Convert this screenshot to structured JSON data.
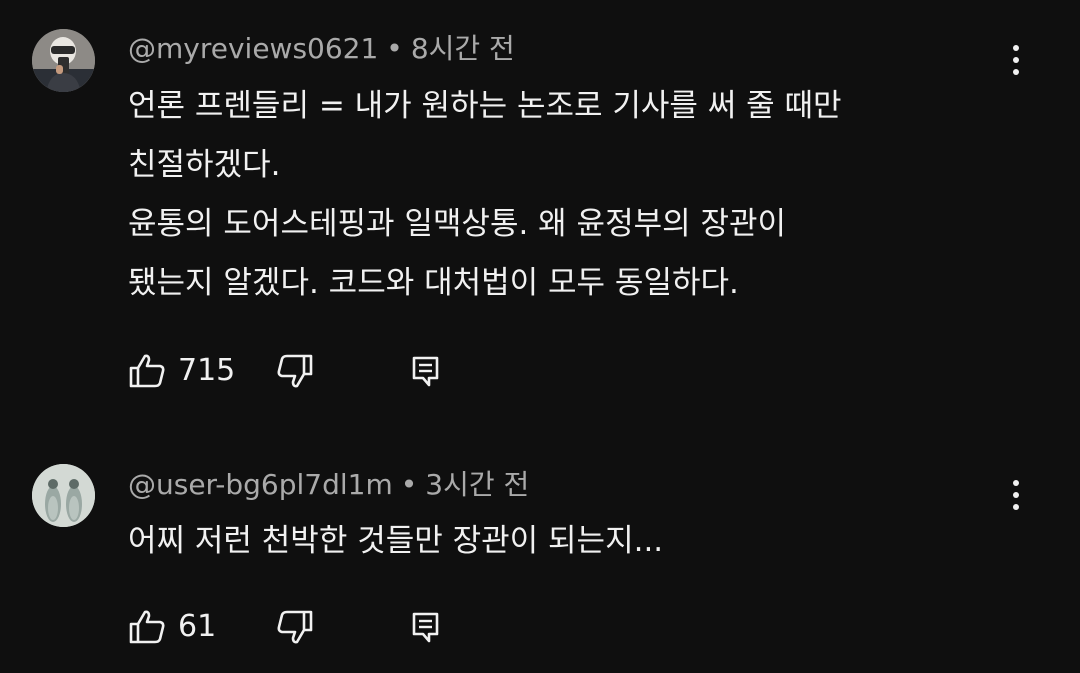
{
  "comments": [
    {
      "handle": "@myreviews0621",
      "separator": "•",
      "time": "8시간 전",
      "lines": [
        "언론 프렌들리 = 내가 원하는 논조로 기사를 써 줄 때만",
        "친절하겠다.",
        "윤통의 도어스테핑과 일맥상통. 왜 윤정부의 장관이",
        "됐는지 알겠다. 코드와 대처법이 모두 동일하다."
      ],
      "likes": "715",
      "avatar_icon": "person-photo-avatar"
    },
    {
      "handle": "@user-bg6pl7dl1m",
      "separator": "•",
      "time": "3시간 전",
      "lines": [
        "어찌 저런 천박한 것들만 장관이 되는지..."
      ],
      "likes": "61",
      "avatar_icon": "birds-avatar"
    }
  ],
  "icons": {
    "like": "thumbs-up-icon",
    "dislike": "thumbs-down-icon",
    "reply": "reply-icon",
    "more": "more-vertical-icon"
  },
  "colors": {
    "background": "#0f0f0f",
    "text": "#f1f1f1",
    "meta": "#aaaaaa"
  }
}
